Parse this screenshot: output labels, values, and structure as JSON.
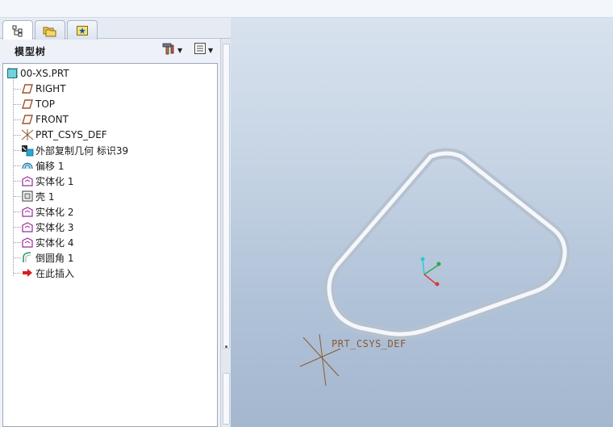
{
  "tabs": [
    {
      "name": "model-tree-tab",
      "icon": "tree-icon",
      "active": true
    },
    {
      "name": "folder-browser-tab",
      "icon": "folders-icon",
      "active": false
    },
    {
      "name": "favorites-tab",
      "icon": "star-icon",
      "active": false
    }
  ],
  "tree_header": {
    "title": "模型树",
    "settings_icon": "hammer-icon",
    "show_icon": "list-icon"
  },
  "tree": {
    "items": [
      {
        "label": "00-XS.PRT",
        "icon": "part-icon",
        "level": 0
      },
      {
        "label": "RIGHT",
        "icon": "datum-plane-icon",
        "level": 1
      },
      {
        "label": "TOP",
        "icon": "datum-plane-icon",
        "level": 1
      },
      {
        "label": "FRONT",
        "icon": "datum-plane-icon",
        "level": 1
      },
      {
        "label": "PRT_CSYS_DEF",
        "icon": "csys-icon",
        "level": 1
      },
      {
        "label": "外部复制几何 标识39",
        "icon": "external-copy-geom-icon",
        "level": 1
      },
      {
        "label": "偏移 1",
        "icon": "offset-icon",
        "level": 1
      },
      {
        "label": "实体化 1",
        "icon": "solidify-icon",
        "level": 1
      },
      {
        "label": "壳 1",
        "icon": "shell-icon",
        "level": 1
      },
      {
        "label": "实体化 2",
        "icon": "solidify-icon",
        "level": 1
      },
      {
        "label": "实体化 3",
        "icon": "solidify-icon",
        "level": 1
      },
      {
        "label": "实体化 4",
        "icon": "solidify-icon",
        "level": 1
      },
      {
        "label": "倒圆角 1",
        "icon": "round-icon",
        "level": 1
      },
      {
        "label": "在此插入",
        "icon": "insert-here-arrow-icon",
        "level": 1
      }
    ]
  },
  "viewport": {
    "csys_label": "PRT_CSYS_DEF",
    "colors": {
      "background_top": "#d8e2ee",
      "background_bottom": "#a4b7cf",
      "csys_color": "#8a5a2e",
      "axis_x": "#2fa84f",
      "axis_y": "#35c6d6",
      "axis_z": "#d83a3a"
    }
  }
}
